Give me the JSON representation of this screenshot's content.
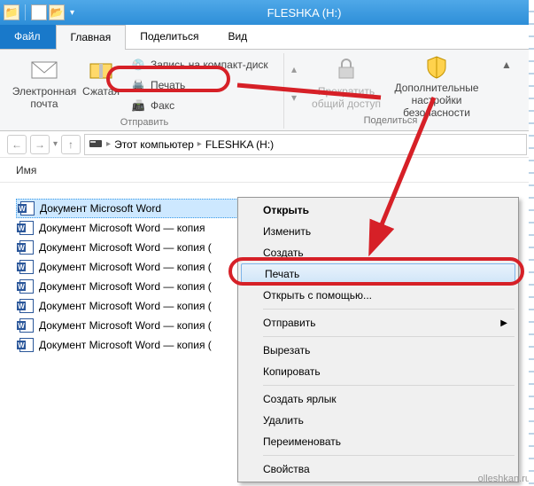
{
  "window": {
    "title": "FLESHKA (H:)"
  },
  "tabs": {
    "file": "Файл",
    "home": "Главная",
    "share": "Поделиться",
    "view": "Вид"
  },
  "ribbon": {
    "email": "Электронная почта",
    "zip": "Сжатая",
    "burn": "Запись на компакт-диск",
    "print": "Печать",
    "fax": "Факс",
    "stop_share": "Прекратить общий доступ",
    "security": "Дополнительные настройки безопасности",
    "group_send": "Отправить",
    "group_share": "Поделиться"
  },
  "breadcrumb": {
    "pc": "Этот компьютер",
    "drive": "FLESHKA (H:)"
  },
  "columns": {
    "name": "Имя"
  },
  "files": {
    "f0": "Документ Microsoft Word",
    "f1": "Документ Microsoft Word — копия",
    "f2": "Документ Microsoft Word — копия (",
    "f3": "Документ Microsoft Word — копия (",
    "f4": "Документ Microsoft Word — копия (",
    "f5": "Документ Microsoft Word — копия (",
    "f6": "Документ Microsoft Word — копия (",
    "f7": "Документ Microsoft Word — копия ("
  },
  "ctx": {
    "open": "Открыть",
    "edit": "Изменить",
    "create": "Создать",
    "print": "Печать",
    "open_with": "Открыть с помощью...",
    "send_to": "Отправить",
    "cut": "Вырезать",
    "copy": "Копировать",
    "shortcut": "Создать ярлык",
    "delete": "Удалить",
    "rename": "Переименовать",
    "props": "Свойства"
  },
  "watermark": "olleshkan.ru"
}
